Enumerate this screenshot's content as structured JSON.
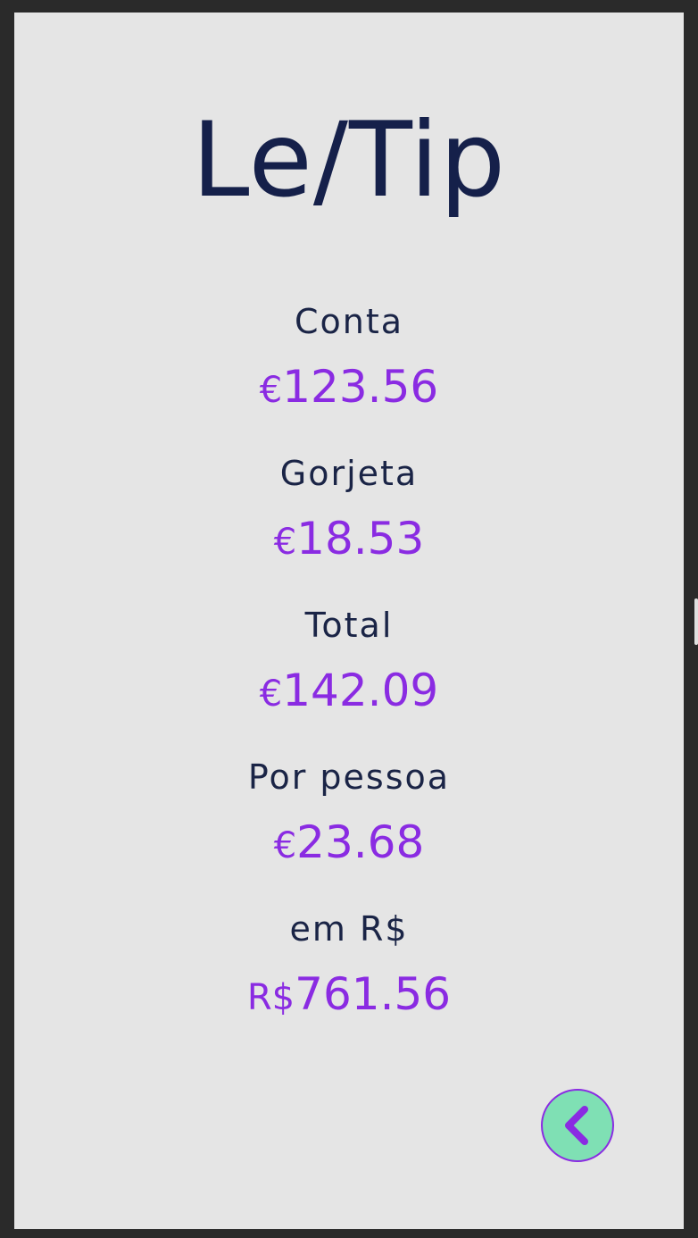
{
  "app": {
    "title": "Le/Tip"
  },
  "summary": {
    "conta": {
      "label": "Conta",
      "currency": "€",
      "amount": "123.56"
    },
    "gorjeta": {
      "label": "Gorjeta",
      "currency": "€",
      "amount": "18.53"
    },
    "total": {
      "label": "Total",
      "currency": "€",
      "amount": "142.09"
    },
    "por_pessoa": {
      "label": "Por pessoa",
      "currency": "€",
      "amount": "23.68"
    },
    "em_brl": {
      "label": "em R$",
      "currency": "R$",
      "amount": "761.56"
    }
  },
  "back_button": {
    "icon": "chevron-left-icon"
  },
  "colors": {
    "background": "#e5e5e5",
    "title": "#15204a",
    "label": "#1a2446",
    "accent": "#8a2be2",
    "button_fill": "#7fe0b4"
  }
}
